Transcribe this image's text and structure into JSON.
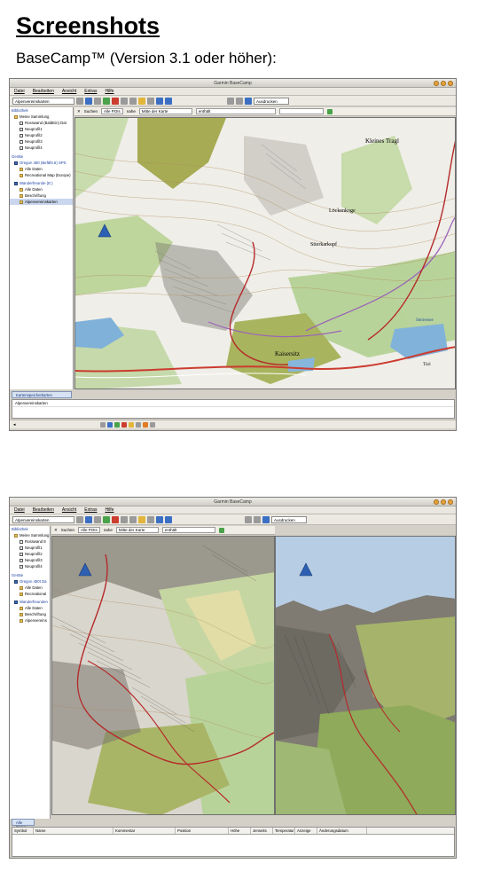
{
  "doc": {
    "title": "Screenshots",
    "subtitle": "BaseCamp™ (Version 3.1 oder höher):"
  },
  "window1": {
    "title": "Garmin BaseCamp",
    "menu": [
      "Datei",
      "Bearbeiten",
      "Ansicht",
      "Extras",
      "Hilfe"
    ],
    "toolbar_combo": "Alpenvereinskarten",
    "toolbar_right_combo": "Ausdrucken",
    "search": {
      "label": "Suchen",
      "scope": "Alle POIs",
      "near": "nahe",
      "location": "Mitte der Karte",
      "mode": "enthält"
    },
    "sidebar": {
      "library_header": "Bibliothek",
      "items": [
        "Meine Sammlung",
        "Rosswand (BaldEin) Dat",
        "Neuprofil1",
        "Neuprofil2",
        "Neuprofil3",
        "Neuprofil4"
      ],
      "devices_header": "Geräte",
      "device": "Oregon 450 (Befäht.6) SPS",
      "device_items": [
        "Alle Daten",
        "Recreational Map (Europe)"
      ],
      "watch_header": "Wanderfreunde (E:)",
      "watch_items": [
        "Alle Daten",
        "Beschriftung",
        "Alpenvereinskarten"
      ]
    },
    "map_labels": [
      "Kleines Tragl",
      "Löckenkoge",
      "Stierkarkopf",
      "Kaisersitz",
      "Steirersee",
      "Törl"
    ],
    "bottom_tab": "Kartenspeicherkarten",
    "bottom_row": "Alpenvereinskarten"
  },
  "window2": {
    "title": "Garmin BaseCamp",
    "menu": [
      "Datei",
      "Bearbeiten",
      "Ansicht",
      "Extras",
      "Hilfe"
    ],
    "toolbar_combo": "Alpenvereinskarten",
    "toolbar_right_combo": "Ausdrucken",
    "search": {
      "label": "Suchen",
      "scope": "Alle POIs",
      "near": "nahe",
      "location": "Mitte der Karte",
      "mode": "enthält"
    },
    "sidebar": {
      "library_header": "Bibliothek",
      "items": [
        "Meine Sammlung",
        "Rosswand 8",
        "Neuprofil1",
        "Neuprofil2",
        "Neuprofil3",
        "Neuprofil4"
      ],
      "devices_header": "Geräte",
      "device": "Oregon 450t Da",
      "device_items": [
        "Alle Daten",
        "Recreational"
      ],
      "watch_header": "Wanderfreunden",
      "watch_items": [
        "Alle Daten",
        "Beschriftung",
        "Alpenvereins"
      ]
    },
    "bottom_tab": "Alle Daten",
    "columns": [
      "Symbol",
      "Name",
      "Kommentar",
      "Position",
      "Höhe",
      "Jenseits",
      "Temperatur",
      "Anzeige",
      "Änderungsdatum"
    ]
  },
  "colors": {
    "window_bg": "#d4d0c8",
    "map_green": "#b9d39b",
    "map_olive": "#a8ad55",
    "route_red": "#b52a2a",
    "sky": "#b7cde4"
  }
}
